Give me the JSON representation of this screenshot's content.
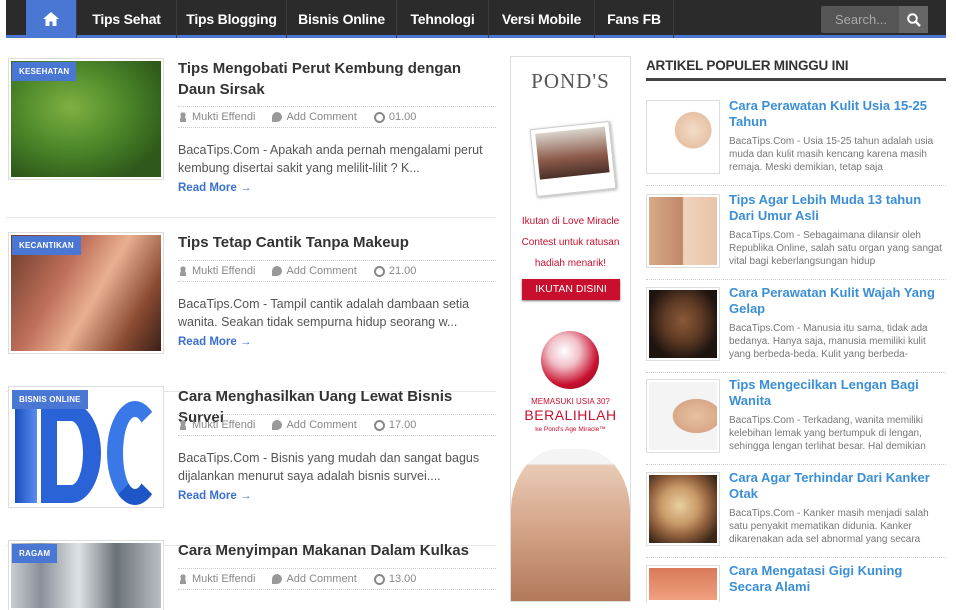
{
  "nav": {
    "items": [
      "Tips Sehat",
      "Tips Blogging",
      "Bisnis Online",
      "Tehnologi",
      "Versi Mobile",
      "Fans FB"
    ],
    "search_placeholder": "Search..."
  },
  "posts": [
    {
      "category": "KESEHATAN",
      "title": "Tips Mengobati Perut Kembung dengan Daun Sirsak",
      "author": "Mukti Effendi",
      "comment": "Add Comment",
      "time": "01.00",
      "excerpt": "BacaTips.Com - Apakah anda pernah mengalami perut kembung disertai sakit yang melilit-lilit ? K...",
      "more": "Read More →"
    },
    {
      "category": "KECANTIKAN",
      "title": "Tips Tetap Cantik Tanpa Makeup",
      "author": "Mukti Effendi",
      "comment": "Add Comment",
      "time": "21.00",
      "excerpt": "BacaTips.Com - Tampil cantik adalah dambaan setia wanita. Seakan tidak sempurna hidup seorang w...",
      "more": "Read More →"
    },
    {
      "category": "BISNIS ONLINE",
      "title": "Cara Menghasilkan Uang Lewat Bisnis Survei",
      "author": "Mukti Effendi",
      "comment": "Add Comment",
      "time": "17.00",
      "excerpt": "BacaTips.Com - Bisnis yang mudah dan sangat bagus dijalankan menurut saya adalah bisnis survei....",
      "more": "Read More →"
    },
    {
      "category": "RAGAM",
      "title": "Cara Menyimpan Makanan Dalam Kulkas",
      "author": "Mukti Effendi",
      "comment": "Add Comment",
      "time": "13.00",
      "excerpt": "",
      "more": ""
    }
  ],
  "ad": {
    "brand": "POND'S",
    "text1": "Ikutan di Love Miracle Contest untuk ratusan hadiah menarik!",
    "cta": "IKUTAN DISINI",
    "text2": "MEMASUKI USIA 30?",
    "text3": "BERALIHLAH",
    "text4": "ke Pond's Age Miracle™"
  },
  "sidebar": {
    "heading": "ARTIKEL POPULER MINGGU INI",
    "items": [
      {
        "title": "Cara Perawatan Kulit Usia 15-25 Tahun",
        "desc": "BacaTips.Com - Usia 15-25 tahun adalah usia muda dan kulit masih kencang karena masih remaja. Meski demikian, tetap saja"
      },
      {
        "title": "Tips Agar Lebih Muda 13 tahun Dari Umur Asli",
        "desc": "BacaTips.Com - Sebagaimana dilansir oleh Republika Online, salah satu organ yang sangat vital bagi keberlangsungan hidup"
      },
      {
        "title": "Cara Perawatan Kulit Wajah Yang Gelap",
        "desc": "BacaTips.Com - Manusia itu sama, tidak ada bedanya. Hanya saja, manusia memiliki kulit yang berbeda-beda. Kulit yang berbeda-"
      },
      {
        "title": "Tips Mengecilkan Lengan Bagi Wanita",
        "desc": "BacaTips.Com - Terkadang, wanita memiliki kelebihan lemak yang bertumpuk di lengan, sehingga lengan terlihat besar. Hal demikian"
      },
      {
        "title": "Cara Agar Terhindar Dari Kanker Otak",
        "desc": "BacaTips.Com - Kanker masih menjadi salah satu penyakit mematikan didunia. Kanker dikarenakan ada sel abnormal yang secara"
      },
      {
        "title": "Cara Mengatasi Gigi Kuning Secara Alami",
        "desc": ""
      }
    ]
  }
}
